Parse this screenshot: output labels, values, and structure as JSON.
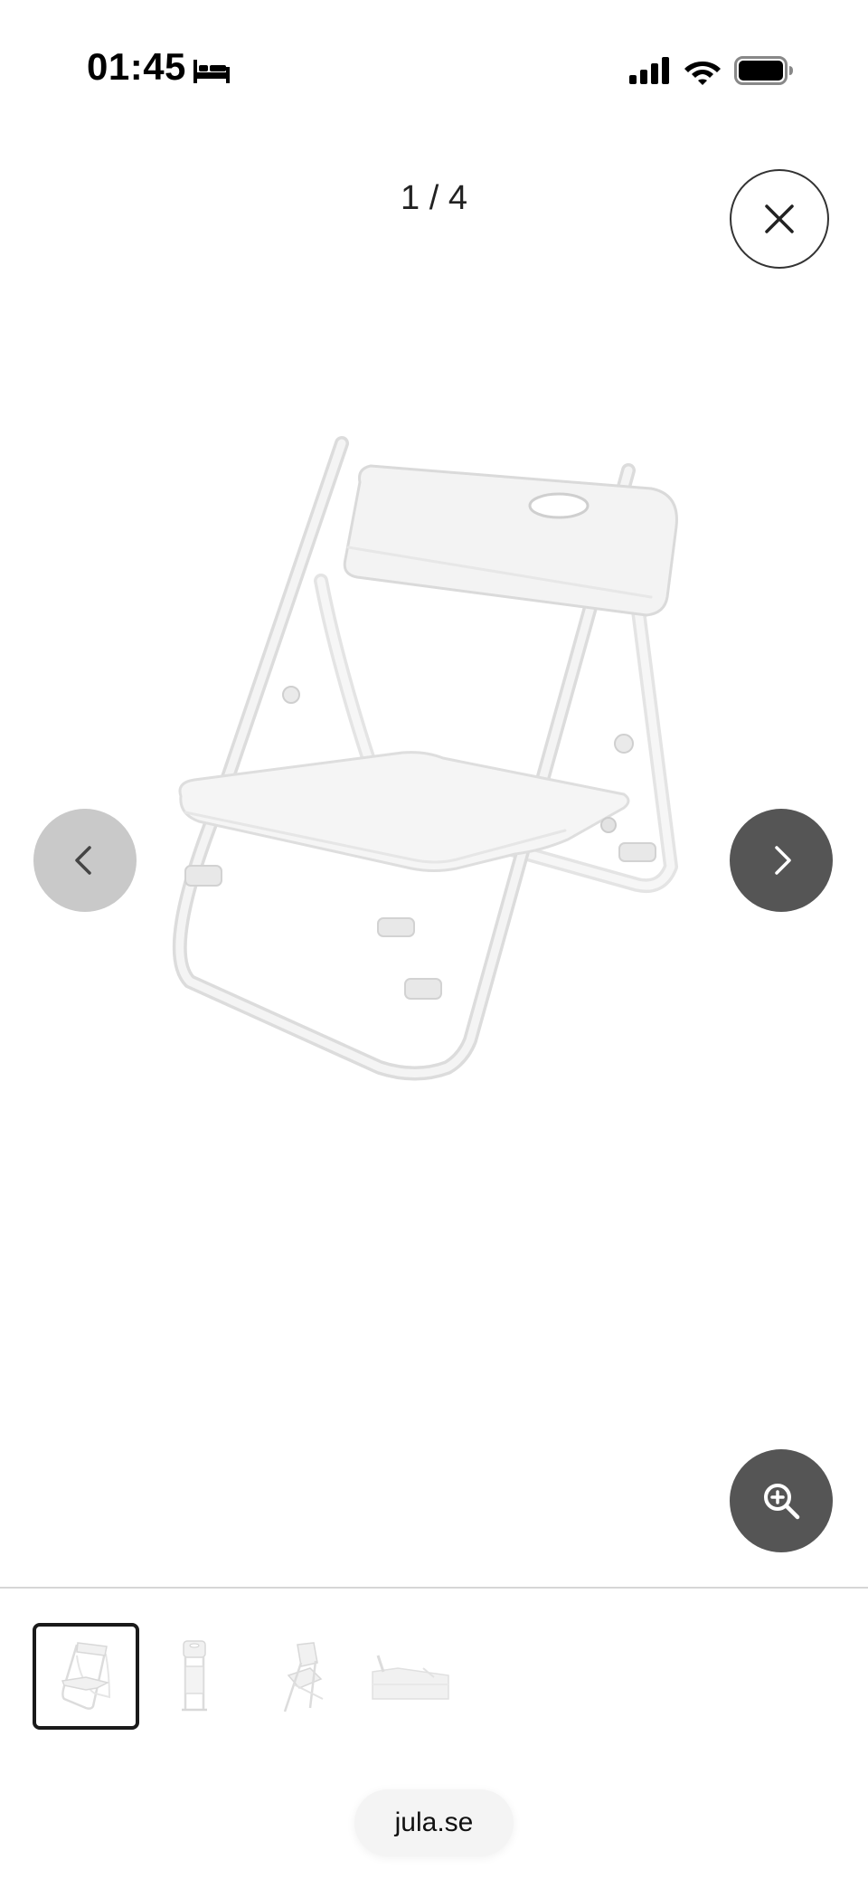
{
  "status_bar": {
    "time": "01:45",
    "icons": [
      "bed-icon",
      "cellular-signal-icon",
      "wifi-icon",
      "battery-icon"
    ]
  },
  "gallery": {
    "counter": "1 / 4",
    "close_icon": "close-icon",
    "prev_icon": "chevron-left-icon",
    "next_icon": "chevron-right-icon",
    "zoom_icon": "zoom-in-icon",
    "main_image": "white-folding-chair",
    "thumbnails": [
      {
        "name": "chair-front-view",
        "selected": true
      },
      {
        "name": "chair-folded-view",
        "selected": false
      },
      {
        "name": "chair-side-view",
        "selected": false
      },
      {
        "name": "chair-seat-detail",
        "selected": false
      }
    ]
  },
  "browser": {
    "url": "jula.se"
  },
  "colors": {
    "nav_dark": "#555555",
    "nav_light": "#c9c9c9",
    "selected_border": "#1a1a1a",
    "background": "#ffffff"
  }
}
